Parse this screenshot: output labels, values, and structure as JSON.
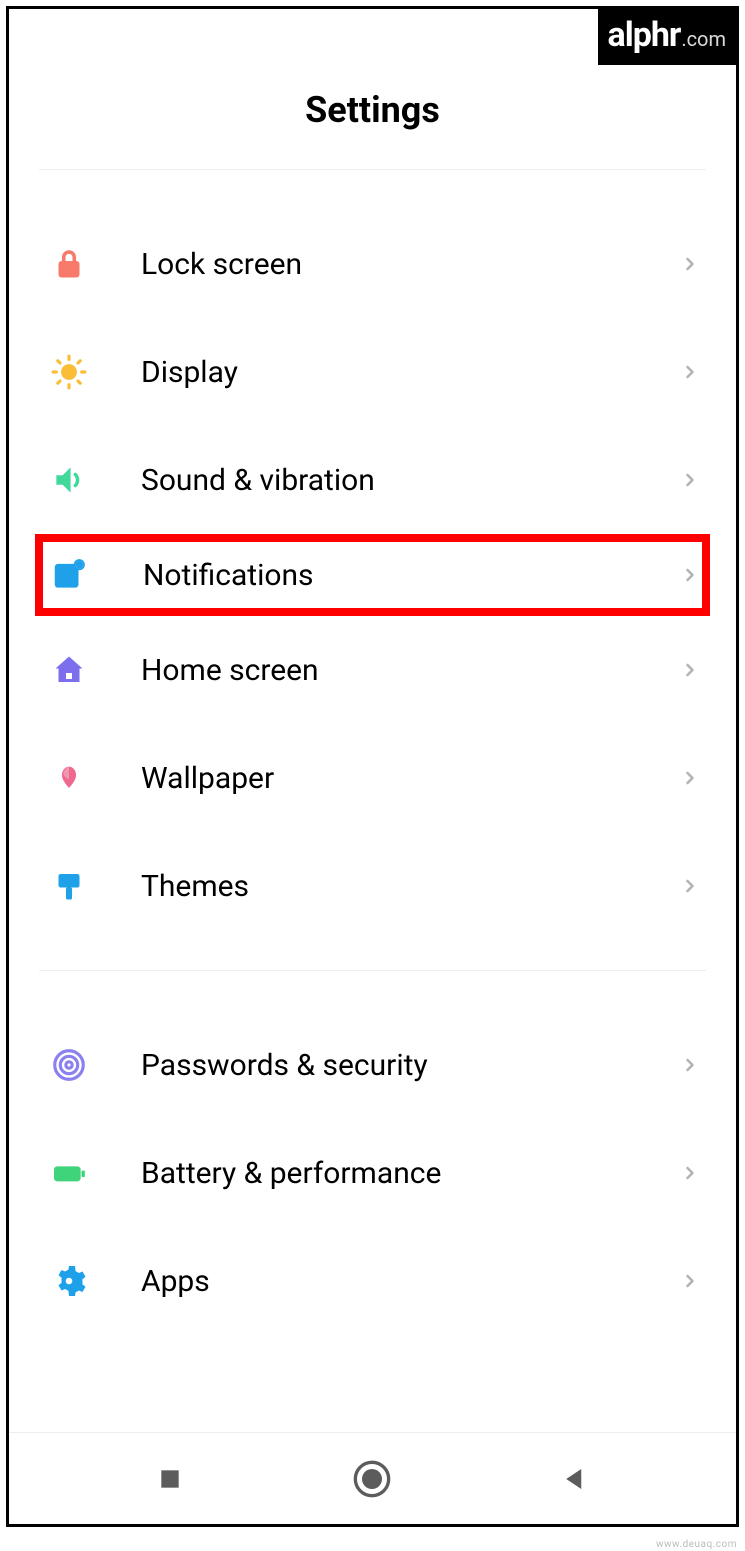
{
  "watermark": {
    "brand": "alphr",
    "ext": ".com"
  },
  "header": {
    "title": "Settings"
  },
  "sections": [
    {
      "items": [
        {
          "id": "lock-screen",
          "label": "Lock screen",
          "icon": "lock-icon",
          "color": "#f77a6a",
          "highlighted": false
        },
        {
          "id": "display",
          "label": "Display",
          "icon": "sun-icon",
          "color": "#fbbc37",
          "highlighted": false
        },
        {
          "id": "sound-vibration",
          "label": "Sound & vibration",
          "icon": "speaker-icon",
          "color": "#41d99b",
          "highlighted": false
        },
        {
          "id": "notifications",
          "label": "Notifications",
          "icon": "notification-icon",
          "color": "#1fa1ea",
          "highlighted": true
        },
        {
          "id": "home-screen",
          "label": "Home screen",
          "icon": "home-icon",
          "color": "#7c6fed",
          "highlighted": false
        },
        {
          "id": "wallpaper",
          "label": "Wallpaper",
          "icon": "flower-icon",
          "color": "#ed6a8e",
          "highlighted": false
        },
        {
          "id": "themes",
          "label": "Themes",
          "icon": "brush-icon",
          "color": "#1fa1ea",
          "highlighted": false
        }
      ]
    },
    {
      "items": [
        {
          "id": "passwords-security",
          "label": "Passwords & security",
          "icon": "fingerprint-icon",
          "color": "#8a80ef",
          "highlighted": false
        },
        {
          "id": "battery-performance",
          "label": "Battery & performance",
          "icon": "battery-icon",
          "color": "#3fd47a",
          "highlighted": false
        },
        {
          "id": "apps",
          "label": "Apps",
          "icon": "gear-icon",
          "color": "#1fa1ea",
          "highlighted": false
        }
      ]
    }
  ],
  "navbar": {
    "recent": "recent-apps",
    "home": "home",
    "back": "back"
  },
  "attribution": "www.deuaq.com"
}
